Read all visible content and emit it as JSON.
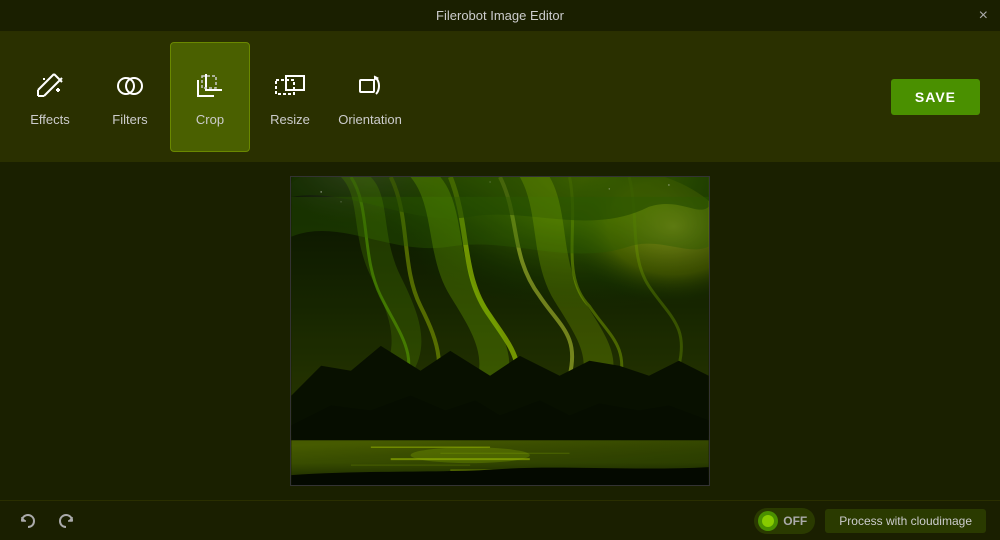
{
  "titleBar": {
    "title": "Filerobot Image Editor",
    "closeLabel": "×"
  },
  "toolbar": {
    "items": [
      {
        "id": "effects",
        "label": "Effects",
        "icon": "wand"
      },
      {
        "id": "filters",
        "label": "Filters",
        "icon": "filters"
      },
      {
        "id": "crop",
        "label": "Crop",
        "icon": "crop",
        "active": true
      },
      {
        "id": "resize",
        "label": "Resize",
        "icon": "resize"
      },
      {
        "id": "orientation",
        "label": "Orientation",
        "icon": "orientation"
      }
    ],
    "saveLabel": "SAVE"
  },
  "bottomBar": {
    "undoLabel": "undo",
    "redoLabel": "redo",
    "toggleLabel": "OFF",
    "cloudimageLabel": "Process with cloudimage"
  }
}
